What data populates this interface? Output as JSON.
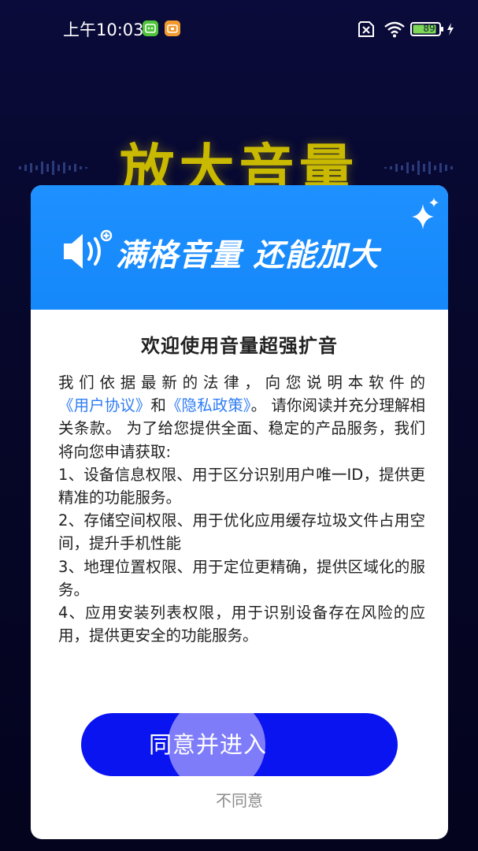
{
  "status_bar": {
    "time": "上午10:03",
    "battery_level": "89"
  },
  "background": {
    "title": "放大音量"
  },
  "dialog": {
    "header_slogan": "满格音量 还能加大",
    "title": "欢迎使用音量超强扩音",
    "intro_text_1": "我们依据最新的法律，向您说明本软件的",
    "user_agreement_link": "《用户协议》",
    "intro_and": "和",
    "privacy_policy_link": "《隐私政策》",
    "intro_text_2": "。 请你阅读并充分理解相关条款。 为了给您提供全面、稳定的产品服务，我们将向您申请获取:",
    "permissions": [
      "1、设备信息权限、用于区分识别用户唯一ID，提供更精准的功能服务。",
      "2、存储空间权限、用于优化应用缓存垃圾文件占用空间，提升手机性能",
      "3、地理位置权限、用于定位更精确，提供区域化的服务。",
      "4、应用安装列表权限，用于识别设备存在风险的应用，提供更安全的功能服务。"
    ],
    "agree_label": "同意并进入",
    "disagree_label": "不同意"
  },
  "colors": {
    "header_blue": "#1a8cff",
    "button_blue": "#0a14f0",
    "link_blue": "#2d7cf6",
    "background_title_yellow": "#c9b900"
  },
  "icons": [
    "speaker-plus-icon",
    "sparkle-icon",
    "sim-off-icon",
    "wifi-icon",
    "battery-icon",
    "charging-icon"
  ]
}
